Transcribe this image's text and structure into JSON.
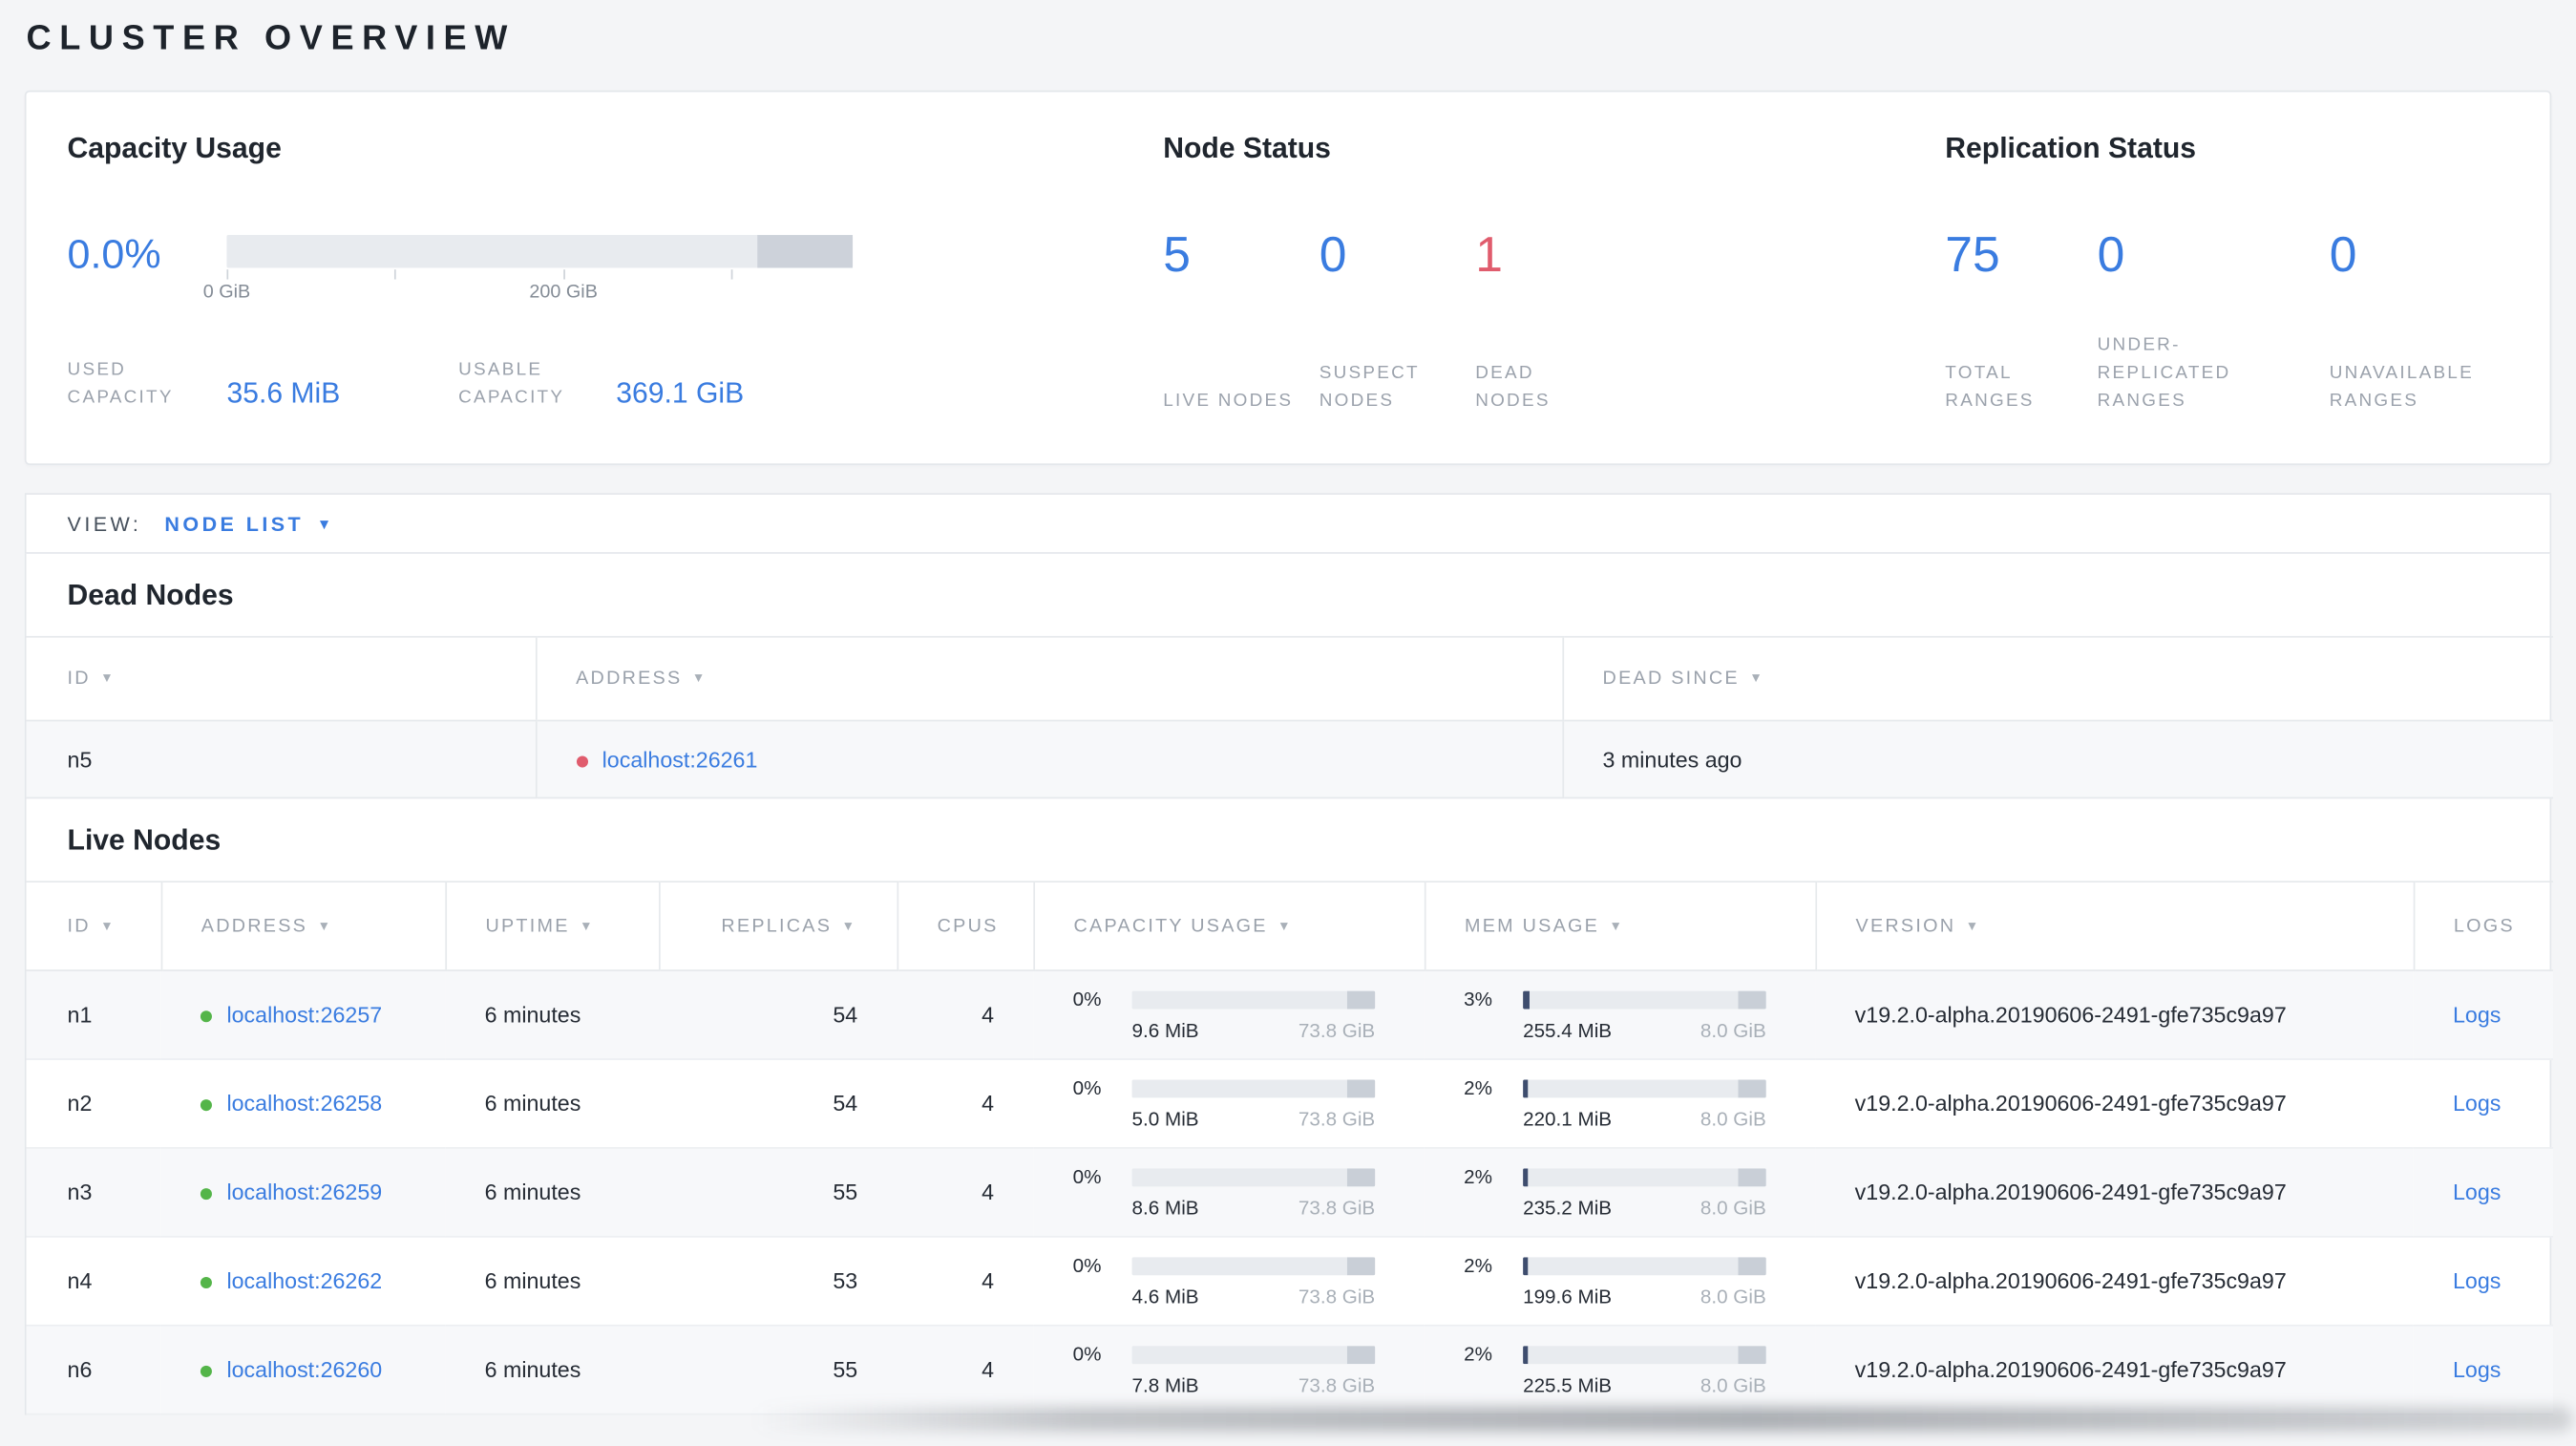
{
  "page": {
    "title": "CLUSTER OVERVIEW"
  },
  "colors": {
    "accent_blue": "#3a7ce0",
    "danger_red": "#e05c6d",
    "healthy_green": "#54b549"
  },
  "icons": {
    "sort_caret_glyph": "▼",
    "view_caret_glyph": "▼"
  },
  "summary": {
    "capacity": {
      "title": "Capacity Usage",
      "percent": "0.0%",
      "axis": {
        "tick_labels": [
          "0 GiB",
          "200 GiB"
        ]
      },
      "used_label": "USED CAPACITY",
      "used_value": "35.6 MiB",
      "usable_label": "USABLE CAPACITY",
      "usable_value": "369.1 GiB"
    },
    "node_status": {
      "title": "Node Status",
      "stats": [
        {
          "value": "5",
          "label": "LIVE NODES",
          "tone": "blue"
        },
        {
          "value": "0",
          "label": "SUSPECT NODES",
          "tone": "blue"
        },
        {
          "value": "1",
          "label": "DEAD NODES",
          "tone": "red"
        }
      ]
    },
    "replication": {
      "title": "Replication Status",
      "stats": [
        {
          "value": "75",
          "label": "TOTAL RANGES",
          "tone": "blue"
        },
        {
          "value": "0",
          "label": "UNDER-REPLICATED RANGES",
          "tone": "blue"
        },
        {
          "value": "0",
          "label": "UNAVAILABLE RANGES",
          "tone": "blue"
        }
      ]
    }
  },
  "view_bar": {
    "label": "VIEW:",
    "selected": "NODE LIST"
  },
  "dead_nodes": {
    "title": "Dead Nodes",
    "columns": [
      {
        "label": "ID",
        "sortable": true
      },
      {
        "label": "ADDRESS",
        "sortable": true
      },
      {
        "label": "DEAD SINCE",
        "sortable": true
      }
    ],
    "rows": [
      {
        "id": "n5",
        "address": "localhost:26261",
        "dead_since": "3 minutes ago"
      }
    ]
  },
  "live_nodes": {
    "title": "Live Nodes",
    "columns": [
      {
        "label": "ID",
        "sortable": true
      },
      {
        "label": "ADDRESS",
        "sortable": true
      },
      {
        "label": "UPTIME",
        "sortable": true
      },
      {
        "label": "REPLICAS",
        "sortable": true
      },
      {
        "label": "CPUS",
        "sortable": false
      },
      {
        "label": "CAPACITY USAGE",
        "sortable": true
      },
      {
        "label": "MEM USAGE",
        "sortable": true
      },
      {
        "label": "VERSION",
        "sortable": true
      },
      {
        "label": "LOGS",
        "sortable": false
      }
    ],
    "rows": [
      {
        "id": "n1",
        "address": "localhost:26257",
        "uptime": "6 minutes",
        "replicas": "54",
        "cpus": "4",
        "capacity": {
          "percent": "0%",
          "used": "9.6 MiB",
          "total": "73.8 GiB"
        },
        "memory": {
          "percent": "3%",
          "used": "255.4 MiB",
          "total": "8.0 GiB"
        },
        "version": "v19.2.0-alpha.20190606-2491-gfe735c9a97",
        "logs_label": "Logs"
      },
      {
        "id": "n2",
        "address": "localhost:26258",
        "uptime": "6 minutes",
        "replicas": "54",
        "cpus": "4",
        "capacity": {
          "percent": "0%",
          "used": "5.0 MiB",
          "total": "73.8 GiB"
        },
        "memory": {
          "percent": "2%",
          "used": "220.1 MiB",
          "total": "8.0 GiB"
        },
        "version": "v19.2.0-alpha.20190606-2491-gfe735c9a97",
        "logs_label": "Logs"
      },
      {
        "id": "n3",
        "address": "localhost:26259",
        "uptime": "6 minutes",
        "replicas": "55",
        "cpus": "4",
        "capacity": {
          "percent": "0%",
          "used": "8.6 MiB",
          "total": "73.8 GiB"
        },
        "memory": {
          "percent": "2%",
          "used": "235.2 MiB",
          "total": "8.0 GiB"
        },
        "version": "v19.2.0-alpha.20190606-2491-gfe735c9a97",
        "logs_label": "Logs"
      },
      {
        "id": "n4",
        "address": "localhost:26262",
        "uptime": "6 minutes",
        "replicas": "53",
        "cpus": "4",
        "capacity": {
          "percent": "0%",
          "used": "4.6 MiB",
          "total": "73.8 GiB"
        },
        "memory": {
          "percent": "2%",
          "used": "199.6 MiB",
          "total": "8.0 GiB"
        },
        "version": "v19.2.0-alpha.20190606-2491-gfe735c9a97",
        "logs_label": "Logs"
      },
      {
        "id": "n6",
        "address": "localhost:26260",
        "uptime": "6 minutes",
        "replicas": "55",
        "cpus": "4",
        "capacity": {
          "percent": "0%",
          "used": "7.8 MiB",
          "total": "73.8 GiB"
        },
        "memory": {
          "percent": "2%",
          "used": "225.5 MiB",
          "total": "8.0 GiB"
        },
        "version": "v19.2.0-alpha.20190606-2491-gfe735c9a97",
        "logs_label": "Logs"
      }
    ]
  }
}
